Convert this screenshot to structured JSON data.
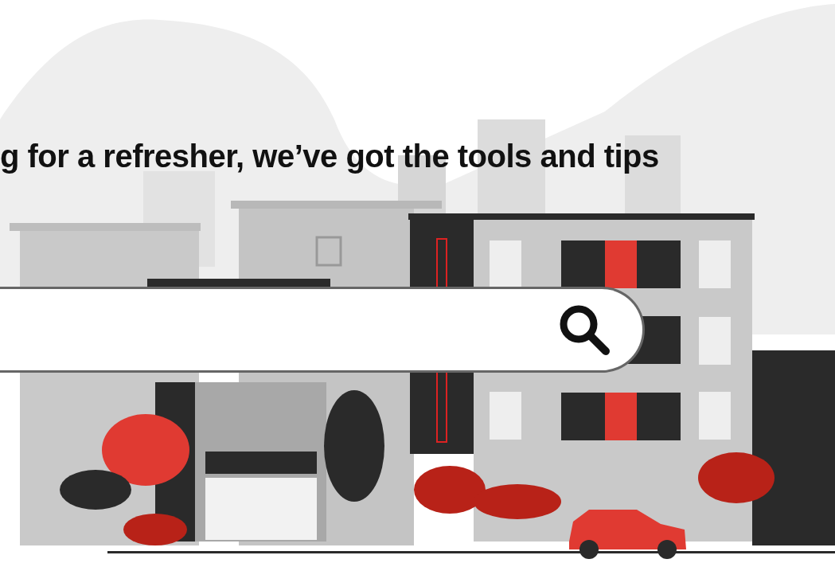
{
  "heading": "g for a refresher, we’ve got the tools and tips"
}
